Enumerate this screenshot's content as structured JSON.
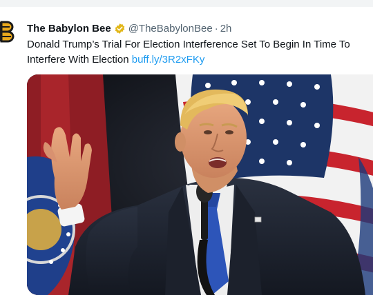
{
  "tweet": {
    "author_name": "The Babylon Bee",
    "handle": "@TheBabylonBee",
    "separator": "·",
    "time": "2h",
    "text": "Donald Trump’s Trial For Election Interference Set To Begin In Time To Interfere With Election ",
    "link": "buff.ly/3R2xFKy",
    "verified_color": "#e2b719",
    "link_color": "#1d9bf0"
  },
  "icons": {
    "avatar": "bee-logo-icon",
    "verified": "verified-badge-icon"
  }
}
